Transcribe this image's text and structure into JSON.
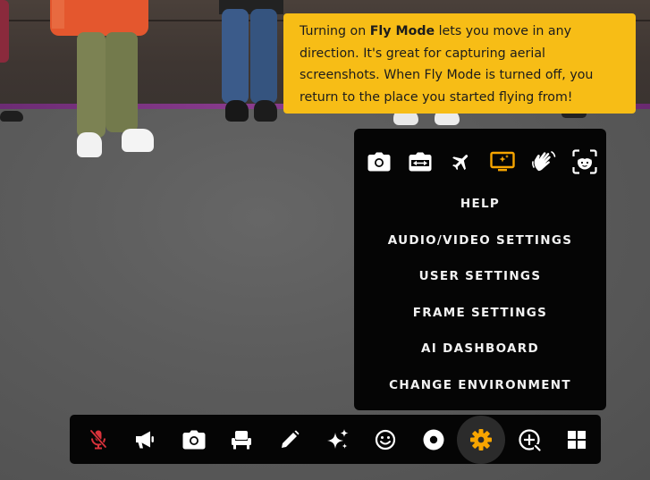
{
  "tooltip": {
    "text_before": "Turning on ",
    "bold": "Fly Mode",
    "text_after": " lets you move in any direction. It's great for capturing aerial screenshots. When Fly Mode is turned off, you return to the place you started flying from!"
  },
  "menu": {
    "icons": [
      {
        "name": "camera-icon",
        "label": "Screenshot"
      },
      {
        "name": "wide-camera-icon",
        "label": "Panorama"
      },
      {
        "name": "airplane-icon",
        "label": "Fly Mode"
      },
      {
        "name": "screen-share-icon",
        "label": "Screen"
      },
      {
        "name": "wave-hand-icon",
        "label": "Wave"
      },
      {
        "name": "face-scan-icon",
        "label": "Avatar"
      }
    ],
    "items": [
      {
        "label": "HELP"
      },
      {
        "label": "AUDIO/VIDEO SETTINGS"
      },
      {
        "label": "USER SETTINGS"
      },
      {
        "label": "FRAME SETTINGS"
      },
      {
        "label": "AI DASHBOARD"
      },
      {
        "label": "CHANGE ENVIRONMENT"
      }
    ]
  },
  "toolbar": {
    "buttons": [
      {
        "name": "mic-muted-icon"
      },
      {
        "name": "megaphone-icon"
      },
      {
        "name": "camera-icon"
      },
      {
        "name": "seat-icon"
      },
      {
        "name": "pencil-icon"
      },
      {
        "name": "sparkles-icon"
      },
      {
        "name": "emoji-icon"
      },
      {
        "name": "record-icon"
      },
      {
        "name": "settings-gear-icon",
        "active": true
      },
      {
        "name": "add-frame-icon"
      },
      {
        "name": "grid-layout-icon"
      }
    ]
  },
  "colors": {
    "tooltip_bg": "#f7bd16",
    "accent": "#f7a500",
    "muted_red": "#d9323b",
    "menu_bg": "#050505"
  }
}
